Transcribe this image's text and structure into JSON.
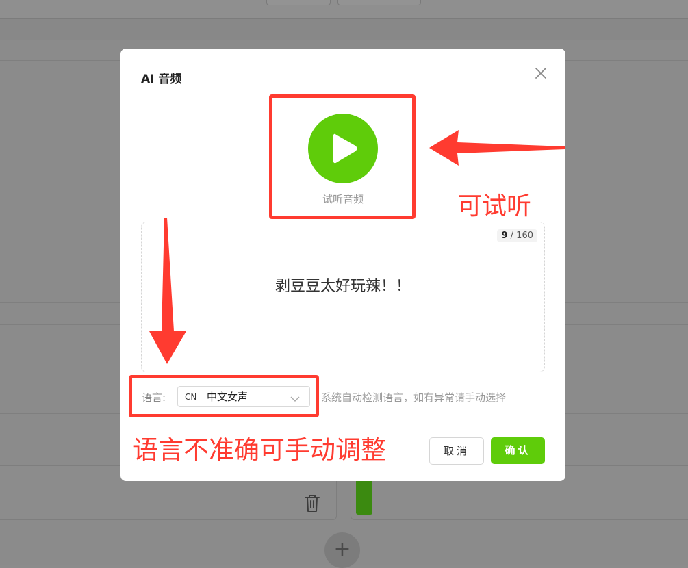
{
  "dialog": {
    "title": "AI 音频",
    "play_label": "试听音频",
    "text": {
      "content": "剥豆豆太好玩辣！！",
      "count_current": "9",
      "count_max": "160"
    },
    "language": {
      "label": "语言:",
      "code": "CN",
      "value": "中文女声",
      "hint": "系统自动检测语言，如有异常请手动选择"
    },
    "buttons": {
      "cancel": "取消",
      "confirm": "确认"
    }
  },
  "annotations": {
    "play_note": "可试听",
    "language_note": "语言不准确可手动调整"
  },
  "colors": {
    "accent": "#5fcc0a",
    "annotation": "#ff3b30"
  }
}
